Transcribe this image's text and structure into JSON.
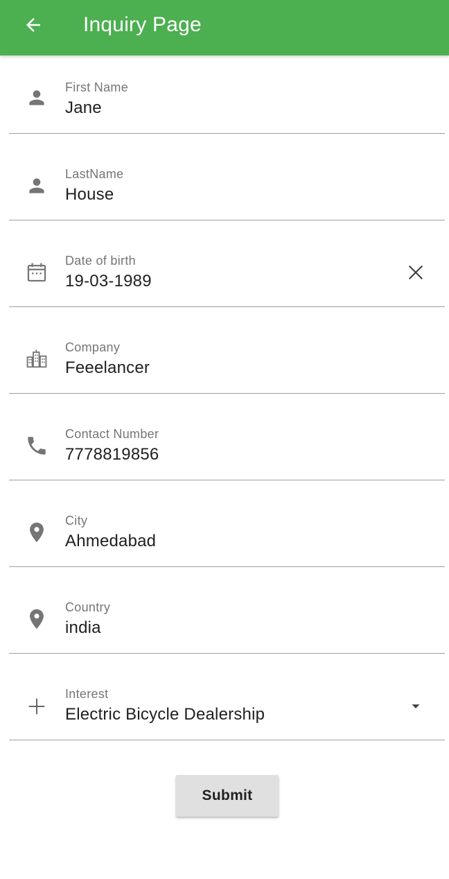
{
  "appbar": {
    "title": "Inquiry Page",
    "back_icon": "arrow-back-icon",
    "color": "#4caf50"
  },
  "fields": [
    {
      "id": "first-name",
      "label": "First Name",
      "value": "Jane",
      "icon": "person-icon"
    },
    {
      "id": "last-name",
      "label": "LastName",
      "value": "House",
      "icon": "person-icon"
    },
    {
      "id": "date-of-birth",
      "label": "Date of birth",
      "value": "19-03-1989",
      "icon": "calendar-icon",
      "suffix_icon": "close-icon"
    },
    {
      "id": "company",
      "label": "Company",
      "value": "Feeelancer",
      "icon": "buildings-icon"
    },
    {
      "id": "contact-number",
      "label": "Contact Number",
      "value": "7778819856",
      "icon": "phone-icon"
    },
    {
      "id": "city",
      "label": "City",
      "value": "Ahmedabad",
      "icon": "location-pin-icon"
    },
    {
      "id": "country",
      "label": "Country",
      "value": "india",
      "icon": "location-pin-icon"
    },
    {
      "id": "interest",
      "label": "Interest",
      "value": "Electric Bicycle Dealership",
      "icon": "plus-icon",
      "suffix_icon": "dropdown-arrow-icon"
    }
  ],
  "submit_label": "Submit"
}
